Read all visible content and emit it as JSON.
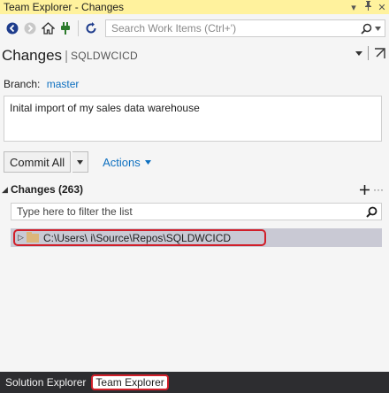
{
  "window": {
    "title": "Team Explorer - Changes",
    "controls": {
      "dropdown": "▾",
      "pin": "ᚔ",
      "close": "✕"
    }
  },
  "toolbar": {
    "icons": [
      "back-icon",
      "forward-icon",
      "home-icon",
      "connect-icon",
      "refresh-icon"
    ],
    "search_placeholder": "Search Work Items (Ctrl+')"
  },
  "header": {
    "title": "Changes",
    "separator": "|",
    "repo": "SQLDWCICD"
  },
  "branch": {
    "label": "Branch:",
    "name": "master"
  },
  "commit_message": "Inital import of my sales data warehouse",
  "commit": {
    "button_label": "Commit All",
    "actions_label": "Actions"
  },
  "changes": {
    "header_label": "Changes (263)",
    "filter_placeholder": "Type here to filter the list",
    "items": [
      {
        "label": "C:\\Users\\       i\\Source\\Repos\\SQLDWCICD"
      }
    ]
  },
  "bottom_tabs": [
    {
      "label": "Solution Explorer",
      "active": false
    },
    {
      "label": "Team Explorer",
      "active": true
    }
  ],
  "colors": {
    "title_bar": "#fff29d",
    "accent_link": "#0e70c0",
    "highlight_border": "#d11f2a",
    "bottom_bar": "#2d2d30"
  }
}
